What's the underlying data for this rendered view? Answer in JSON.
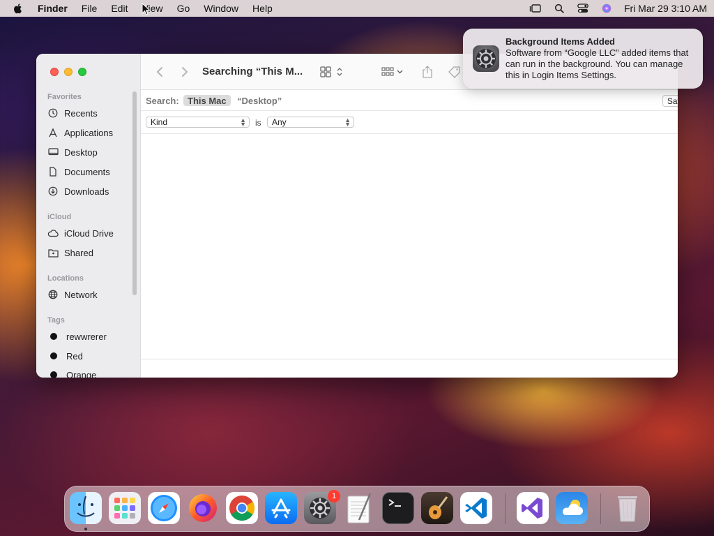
{
  "menubar": {
    "apple_icon": "apple-logo-icon",
    "app_name": "Finder",
    "items": [
      "File",
      "Edit",
      "View",
      "Go",
      "Window",
      "Help"
    ],
    "status_icons": [
      "stage-manager-icon",
      "search-icon",
      "control-center-icon",
      "siri-icon"
    ],
    "clock": "Fri Mar 29  3:10 AM"
  },
  "finder": {
    "title": "Searching “This M...",
    "sidebar": {
      "favorites_header": "Favorites",
      "favorites": [
        {
          "label": "Recents",
          "icon": "clock-icon"
        },
        {
          "label": "Applications",
          "icon": "applications-icon"
        },
        {
          "label": "Desktop",
          "icon": "desktop-icon"
        },
        {
          "label": "Documents",
          "icon": "document-icon"
        },
        {
          "label": "Downloads",
          "icon": "download-icon"
        }
      ],
      "icloud_header": "iCloud",
      "icloud": [
        {
          "label": "iCloud Drive",
          "icon": "cloud-icon"
        },
        {
          "label": "Shared",
          "icon": "shared-folder-icon"
        }
      ],
      "locations_header": "Locations",
      "locations": [
        {
          "label": "Network",
          "icon": "globe-icon"
        }
      ],
      "tags_header": "Tags",
      "tags": [
        {
          "label": "rewwrerer",
          "color": "#111111"
        },
        {
          "label": "Red",
          "color": "#111111"
        },
        {
          "label": "Orange",
          "color": "#111111"
        }
      ]
    },
    "search": {
      "label": "Search:",
      "scope_active": "This Mac",
      "scope_other": "“Desktop”",
      "save_label": "Save",
      "minus": "−",
      "plus": "+"
    },
    "criteria": {
      "attribute": "Kind",
      "operator": "is",
      "value": "Any"
    }
  },
  "notification": {
    "title": "Background Items Added",
    "body": "Software from “Google LLC” added items that can run in the background. You can manage this in Login Items Settings.",
    "icon": "system-settings-gear-icon"
  },
  "dock": {
    "apps": [
      "Finder",
      "Launchpad",
      "Safari",
      "Firefox",
      "Chrome",
      "App Store",
      "System Settings",
      "TextEdit",
      "Terminal",
      "GarageBand",
      "Visual Studio Code",
      "Visual Studio",
      "Weather",
      "Trash"
    ],
    "settings_badge": "1"
  }
}
